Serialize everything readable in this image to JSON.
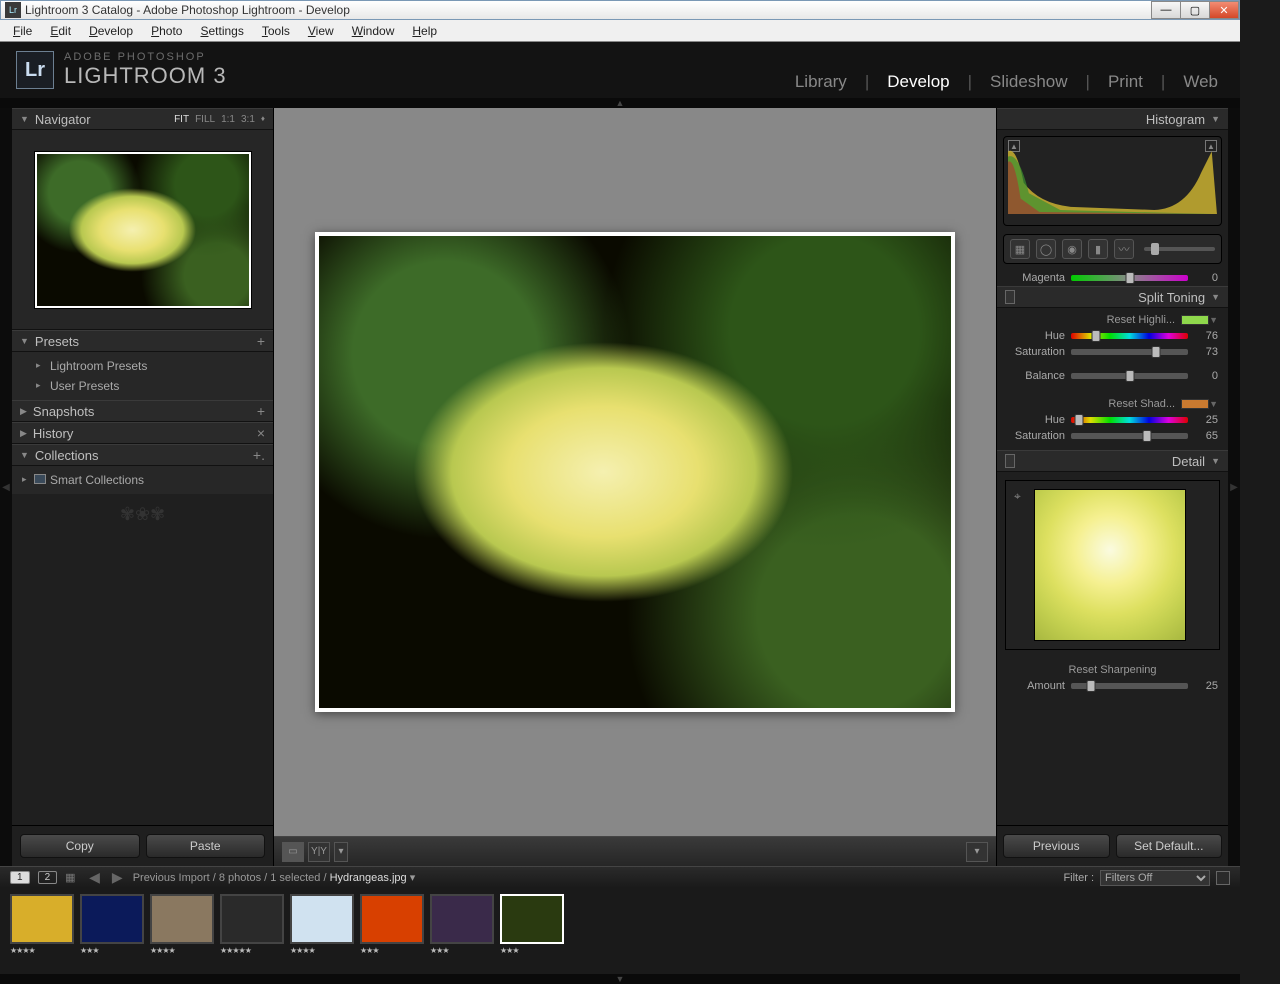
{
  "window": {
    "title": "Lightroom 3 Catalog - Adobe Photoshop Lightroom - Develop"
  },
  "menu": [
    "File",
    "Edit",
    "Develop",
    "Photo",
    "Settings",
    "Tools",
    "View",
    "Window",
    "Help"
  ],
  "brand": {
    "top": "ADOBE PHOTOSHOP",
    "bottom": "LIGHTROOM 3",
    "logo": "Lr"
  },
  "modules": [
    "Library",
    "Develop",
    "Slideshow",
    "Print",
    "Web"
  ],
  "active_module": "Develop",
  "left": {
    "navigator": {
      "title": "Navigator",
      "zoom": [
        "FIT",
        "FILL",
        "1:1",
        "3:1"
      ],
      "active": "FIT"
    },
    "presets": {
      "title": "Presets",
      "items": [
        "Lightroom Presets",
        "User Presets"
      ]
    },
    "snapshots": "Snapshots",
    "history": "History",
    "collections": {
      "title": "Collections",
      "item": "Smart Collections"
    },
    "copy": "Copy",
    "paste": "Paste"
  },
  "right": {
    "histogram": "Histogram",
    "pre_split": {
      "magenta_label": "Magenta",
      "magenta_val": "0"
    },
    "split": {
      "title": "Split Toning",
      "reset_hi": "Reset Highli...",
      "hi_hue_label": "Hue",
      "hi_hue_val": "76",
      "hi_sat_label": "Saturation",
      "hi_sat_val": "73",
      "bal_label": "Balance",
      "bal_val": "0",
      "reset_sh": "Reset Shad...",
      "sh_hue_label": "Hue",
      "sh_hue_val": "25",
      "sh_sat_label": "Saturation",
      "sh_sat_val": "65",
      "hi_swatch": "#8fd84c",
      "sh_swatch": "#c97a30"
    },
    "detail": {
      "title": "Detail",
      "reset_sharp": "Reset Sharpening",
      "amount_label": "Amount",
      "amount_val": "25"
    },
    "previous": "Previous",
    "set_default": "Set Default..."
  },
  "filmstrip": {
    "monitors": [
      "1",
      "2"
    ],
    "path_prefix": "Previous Import / 8 photos / 1 selected / ",
    "filename": "Hydrangeas.jpg",
    "filter_label": "Filter :",
    "filter_value": "Filters Off",
    "thumbs": [
      {
        "stars": "★★★★",
        "bg": "#d8ae2a"
      },
      {
        "stars": "★★★",
        "bg": "#0b1a5a"
      },
      {
        "stars": "★★★★",
        "bg": "#8a7860"
      },
      {
        "stars": "★★★★★",
        "bg": "#2a2a2a"
      },
      {
        "stars": "★★★★",
        "bg": "#d0e2f0"
      },
      {
        "stars": "★★★",
        "bg": "#d84000"
      },
      {
        "stars": "★★★",
        "bg": "#3a2a4a"
      },
      {
        "stars": "★★★",
        "bg": "#2a3a10",
        "selected": true
      }
    ]
  }
}
